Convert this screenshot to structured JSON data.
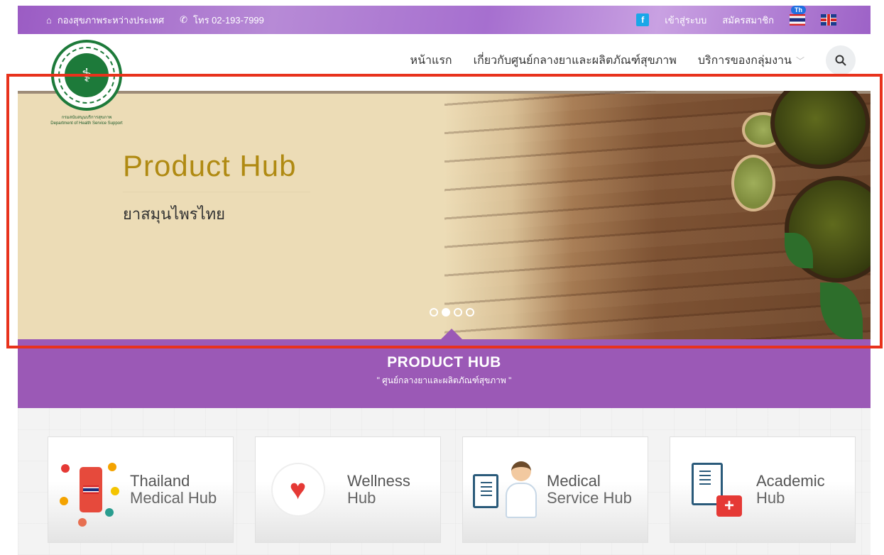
{
  "topbar": {
    "org_label": "กองสุขภาพระหว่างประเทศ",
    "phone_label": "โทร 02-193-7999",
    "facebook_label": "f",
    "login_label": "เข้าสู่ระบบ",
    "register_label": "สมัครสมาชิก",
    "lang_badge": "Th"
  },
  "logo": {
    "ring_text": "MINISTRY OF PUBLIC HEALTH",
    "line1": "กรมสนับสนุนบริการสุขภาพ",
    "line2": "Department of Health Service Support"
  },
  "nav": {
    "items": [
      {
        "label": "หน้าแรก"
      },
      {
        "label": "เกี่ยวกับศูนย์กลางยาและผลิตภัณฑ์สุขภาพ"
      },
      {
        "label": "บริการของกลุ่มงาน"
      }
    ]
  },
  "slider": {
    "title": "Product Hub",
    "subtitle": "ยาสมุนไพรไทย",
    "active_index": 1,
    "slide_count": 4
  },
  "hub_banner": {
    "title": "PRODUCT HUB",
    "subtitle": "\" ศูนย์กลางยาและผลิตภัณฑ์สุขภาพ \""
  },
  "cards": [
    {
      "line1": "Thailand",
      "line2": "Medical Hub",
      "icon": "phone-apps-icon"
    },
    {
      "line1": "Wellness",
      "line2": "Hub",
      "icon": "heart-hand-icon"
    },
    {
      "line1": "Medical",
      "line2": "Service Hub",
      "icon": "doctor-icon"
    },
    {
      "line1": "Academic",
      "line2": "Hub",
      "icon": "clipboard-firstaid-icon"
    }
  ],
  "colors": {
    "brand_purple": "#9b59b6",
    "title_gold": "#b08a12",
    "highlight_red": "#e8321c"
  }
}
